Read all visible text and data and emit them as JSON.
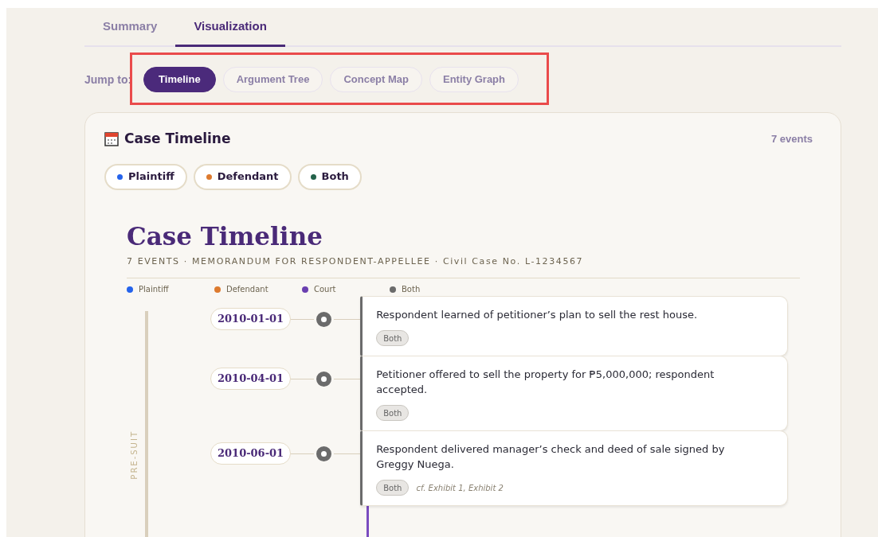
{
  "tabs": [
    {
      "label": "Summary",
      "selected": false
    },
    {
      "label": "Visualization",
      "selected": true
    }
  ],
  "jump": {
    "label": "Jump to:",
    "items": [
      {
        "label": "Timeline",
        "selected": true
      },
      {
        "label": "Argument Tree",
        "selected": false
      },
      {
        "label": "Concept Map",
        "selected": false
      },
      {
        "label": "Entity Graph",
        "selected": false
      }
    ]
  },
  "panel": {
    "title": "Case Timeline",
    "count": "7 events",
    "filters": [
      {
        "label": "Plaintiff",
        "color": "#2563eb"
      },
      {
        "label": "Defendant",
        "color": "#dd7a2e"
      },
      {
        "label": "Both",
        "color": "#23624a"
      }
    ],
    "timeline": {
      "title": "Case Timeline",
      "subtitle": "7 EVENTS · MEMORANDUM FOR RESPONDENT-APPELLEE · Civil Case No. L-1234567",
      "legend": [
        {
          "label": "Plaintiff",
          "color": "#2563eb"
        },
        {
          "label": "Defendant",
          "color": "#dd7a2e"
        },
        {
          "label": "Court",
          "color": "#6a3fb0"
        },
        {
          "label": "Both",
          "color": "#6b6b6b"
        }
      ],
      "phase": "PRE-SUIT",
      "events": [
        {
          "date": "2010-01-01",
          "text": "Respondent learned of petitioner’s plan to sell the rest house.",
          "tag": "Both",
          "color": "#6b6b6b"
        },
        {
          "date": "2010-04-01",
          "text": "Petitioner offered to sell the property for ₱5,000,000; respondent accepted.",
          "tag": "Both",
          "color": "#6b6b6b"
        },
        {
          "date": "2010-06-01",
          "text": "Respondent delivered manager’s check and deed of sale signed by Greggy Nuega.",
          "tag": "Both",
          "note": "cf. Exhibit 1, Exhibit 2",
          "color": "#6b6b6b"
        }
      ]
    }
  }
}
